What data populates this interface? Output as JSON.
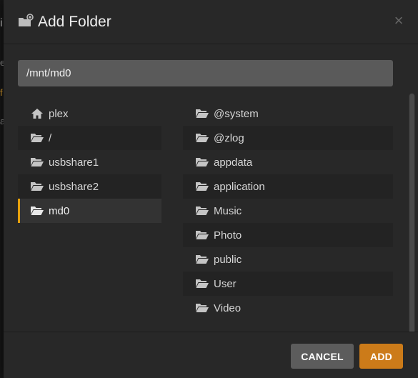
{
  "dialog": {
    "title": "Add Folder",
    "close_label": "×"
  },
  "path": {
    "value": "/mnt/md0"
  },
  "shortcuts": [
    {
      "label": "plex",
      "icon": "home-icon"
    },
    {
      "label": "/",
      "icon": "folder-open-icon"
    },
    {
      "label": "usbshare1",
      "icon": "folder-open-icon"
    },
    {
      "label": "usbshare2",
      "icon": "folder-open-icon"
    },
    {
      "label": "md0",
      "icon": "folder-open-icon",
      "selected": true
    }
  ],
  "folders": [
    {
      "label": "@system"
    },
    {
      "label": "@zlog"
    },
    {
      "label": "appdata"
    },
    {
      "label": "application"
    },
    {
      "label": "Music"
    },
    {
      "label": "Photo"
    },
    {
      "label": "public"
    },
    {
      "label": "User"
    },
    {
      "label": "Video"
    }
  ],
  "footer": {
    "cancel_label": "CANCEL",
    "add_label": "ADD"
  },
  "background": {
    "hints": [
      "i",
      "e",
      "f",
      "a"
    ]
  },
  "colors": {
    "accent": "#e5a00d",
    "add_button": "#cc7b19",
    "cancel_button": "#5c5c5c",
    "modal_bg": "#282828",
    "input_bg": "#5a5a5a"
  }
}
